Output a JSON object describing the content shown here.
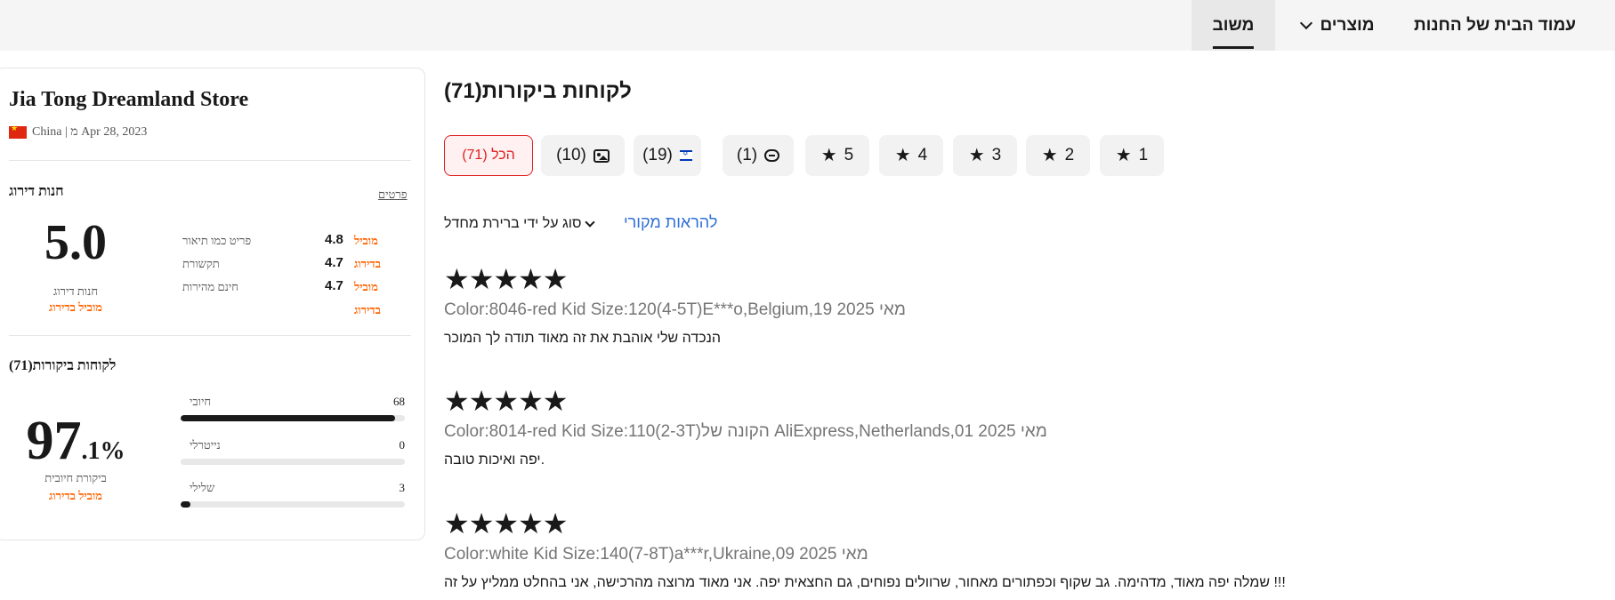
{
  "nav": {
    "home": "עמוד הבית של החנות",
    "products": "מוצרים",
    "feedback": "משוב"
  },
  "store": {
    "name": "Jia Tong Dreamland Store",
    "meta": "China | מ Apr 28, 2023",
    "rating_section_title": "חנות דירוג",
    "details_link": "פרטים",
    "score": "5.0",
    "score_caption": "חנות דירוג",
    "score_badge": "מוביל בדירוג",
    "metrics": [
      {
        "label": "פריט כמו תיאור",
        "value": "4.8",
        "badge": "מוביל"
      },
      {
        "label": "תקשורת",
        "value": "4.7",
        "badge": "בדירוג"
      },
      {
        "label": "חינם מהירות",
        "value": "4.7",
        "badge": "מוביל"
      }
    ],
    "extra_badge": "בדירוג",
    "reviews_section_title": "לקוחות ביקורות(71)",
    "positive_pct_int": "97",
    "positive_pct_dec": ".1%",
    "positive_caption": "ביקורת חיובית",
    "positive_badge": "מוביל בדירוג",
    "breakdown": [
      {
        "label": "חיובי",
        "count": "68",
        "fraction": 0.958
      },
      {
        "label": "נייטרלי",
        "count": "0",
        "fraction": 0
      },
      {
        "label": "שלילי",
        "count": "3",
        "fraction": 0.042
      }
    ]
  },
  "reviews": {
    "title": "לקוחות ביקורות(71)",
    "filters": [
      {
        "label": "הכל (71)",
        "icon": "",
        "active": true
      },
      {
        "label": "(10)",
        "icon": "image-icon",
        "active": false
      },
      {
        "label": "(19)",
        "icon": "israel-flag-icon",
        "active": false
      },
      {
        "label": "(1)",
        "icon": "comment-icon",
        "active": false
      },
      {
        "label": "5",
        "icon": "star-icon",
        "active": false
      },
      {
        "label": "4",
        "icon": "star-icon",
        "active": false
      },
      {
        "label": "3",
        "icon": "star-icon",
        "active": false
      },
      {
        "label": "2",
        "icon": "star-icon",
        "active": false
      },
      {
        "label": "1",
        "icon": "star-icon",
        "active": false
      }
    ],
    "sort_label": "סוג על ידי ברירת מחדל",
    "show_original": "להראות מקורי",
    "items": [
      {
        "rating": 5,
        "meta": "Color:8046-red Kid Size:120(4-5T)E***o,Belgium,19 2025 מאי",
        "text": "הנכדה שלי אוהבת את זה מאוד תודה לך המוכר"
      },
      {
        "rating": 5,
        "meta": "Color:8014-red Kid Size:110(2-3T)הקונה של AliExpress,Netherlands,01 2025 מאי",
        "text": "יפה ואיכות טובה."
      },
      {
        "rating": 5,
        "meta": "Color:white Kid Size:140(7-8T)a***r,Ukraine,09 2025 מאי",
        "text": "שמלה יפה מאוד, מדהימה. גב שקוף וכפתורים מאחור, שרוולים נפוחים, גם החצאית יפה. אני מאוד מרוצה מהרכישה, אני בהחלט ממליץ על זה !!!"
      }
    ]
  }
}
